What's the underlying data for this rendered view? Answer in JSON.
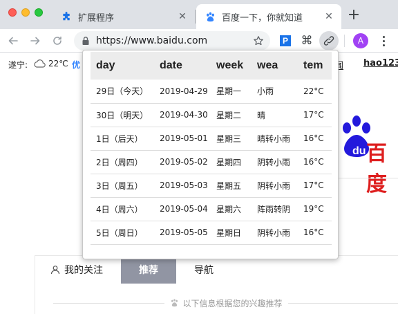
{
  "browser": {
    "tabs": [
      {
        "label": "扩展程序",
        "icon": "puzzle-icon",
        "active": false
      },
      {
        "label": "百度一下，你就知道",
        "icon": "baidu-paw-icon",
        "active": true
      }
    ],
    "url": "https://www.baidu.com",
    "avatar_letter": "A",
    "extension_p_label": "P",
    "extension_cmd_glyph": "⌘",
    "accent_color": "#1a73e8",
    "avatar_color": "#a142f4"
  },
  "page": {
    "city": "遂宁:",
    "weather_icon": "cloud-icon",
    "temperature": "22℃",
    "air_quality": "优",
    "top_link_partial": "闻",
    "top_link_hao": "hao123",
    "logo_partial_text": "百度",
    "feed": {
      "tabs": [
        "我的关注",
        "推荐",
        "导航"
      ],
      "active_tab": "推荐",
      "tip": "以下信息根据您的兴趣推荐"
    }
  },
  "weather_popup": {
    "headers": [
      "day",
      "date",
      "week",
      "wea",
      "tem"
    ],
    "rows": [
      {
        "day": "29日（今天）",
        "date": "2019-04-29",
        "week": "星期一",
        "wea": "小雨",
        "tem": "22°C"
      },
      {
        "day": "30日（明天）",
        "date": "2019-04-30",
        "week": "星期二",
        "wea": "晴",
        "tem": "17°C"
      },
      {
        "day": "1日（后天）",
        "date": "2019-05-01",
        "week": "星期三",
        "wea": "晴转小雨",
        "tem": "16°C"
      },
      {
        "day": "2日（周四）",
        "date": "2019-05-02",
        "week": "星期四",
        "wea": "阴转小雨",
        "tem": "16°C"
      },
      {
        "day": "3日（周五）",
        "date": "2019-05-03",
        "week": "星期五",
        "wea": "阴转小雨",
        "tem": "17°C"
      },
      {
        "day": "4日（周六）",
        "date": "2019-05-04",
        "week": "星期六",
        "wea": "阵雨转阴",
        "tem": "19°C"
      },
      {
        "day": "5日（周日）",
        "date": "2019-05-05",
        "week": "星期日",
        "wea": "阴转小雨",
        "tem": "16°C"
      }
    ]
  }
}
